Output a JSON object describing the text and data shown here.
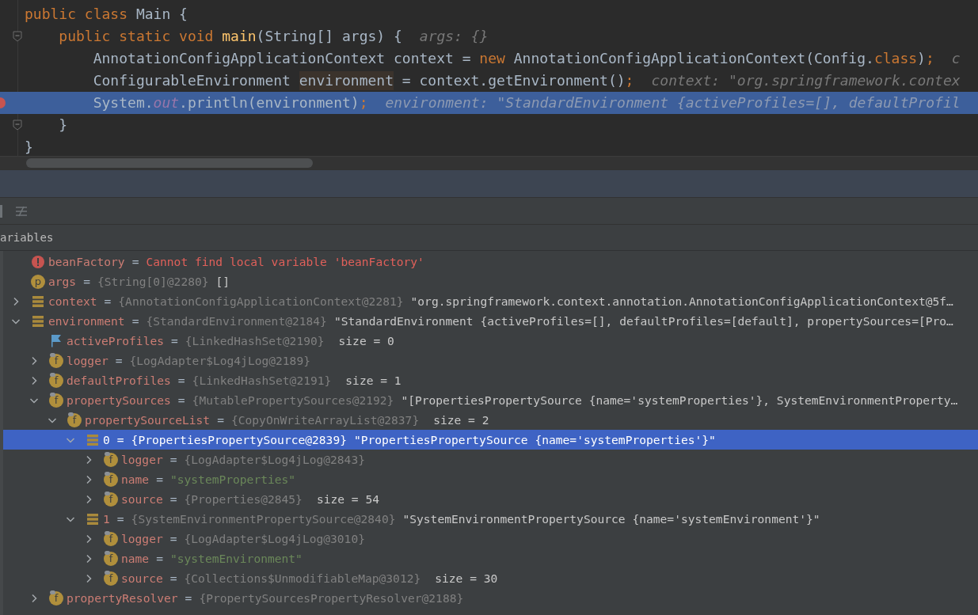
{
  "editor": {
    "lines": [
      {
        "selected": false,
        "fold": false,
        "breakpoint": false,
        "tokens": [
          {
            "kind": "keyword",
            "text": "public class "
          },
          {
            "kind": "plain",
            "text": "Main {"
          }
        ]
      },
      {
        "selected": false,
        "fold": true,
        "breakpoint": false,
        "tokens": [
          {
            "kind": "keyword",
            "text": "    public static void "
          },
          {
            "kind": "function",
            "text": "main"
          },
          {
            "kind": "plain",
            "text": "(String[] args) {"
          },
          {
            "kind": "hint",
            "text": "args: {}"
          }
        ]
      },
      {
        "selected": false,
        "fold": false,
        "breakpoint": false,
        "tokens": [
          {
            "kind": "plain",
            "text": "        AnnotationConfigApplicationContext context = "
          },
          {
            "kind": "keyword",
            "text": "new"
          },
          {
            "kind": "plain",
            "text": " AnnotationConfigApplicationContext(Config."
          },
          {
            "kind": "keyword",
            "text": "class"
          },
          {
            "kind": "plain",
            "text": ")"
          },
          {
            "kind": "keyword",
            "text": ";"
          },
          {
            "kind": "hint",
            "text": "c"
          }
        ]
      },
      {
        "selected": false,
        "fold": false,
        "breakpoint": false,
        "tokens": [
          {
            "kind": "plain",
            "text": "        ConfigurableEnvironment "
          },
          {
            "kind": "usage",
            "text": "environment"
          },
          {
            "kind": "plain",
            "text": " = context.getEnvironment()"
          },
          {
            "kind": "keyword",
            "text": ";"
          },
          {
            "kind": "hint",
            "text": "context: \"org.springframework.contex"
          }
        ]
      },
      {
        "selected": true,
        "fold": false,
        "breakpoint": true,
        "tokens": [
          {
            "kind": "plain",
            "text": "        System."
          },
          {
            "kind": "static",
            "text": "out"
          },
          {
            "kind": "plain",
            "text": ".println(environment)"
          },
          {
            "kind": "keyword",
            "text": ";"
          },
          {
            "kind": "hint",
            "text": "environment: \"StandardEnvironment {activeProfiles=[], defaultProfil"
          }
        ]
      },
      {
        "selected": false,
        "fold": true,
        "breakpoint": false,
        "tokens": [
          {
            "kind": "plain",
            "text": "    }"
          }
        ]
      },
      {
        "selected": false,
        "fold": false,
        "breakpoint": false,
        "tokens": [
          {
            "kind": "plain",
            "text": "}"
          }
        ]
      }
    ]
  },
  "panel": {
    "header": "ariables"
  },
  "variables": [
    {
      "kind": "error",
      "selected": false,
      "name": "beanFactory",
      "eq": "=",
      "value": {
        "kind": "error",
        "text": "Cannot find local variable 'beanFactory'"
      }
    },
    {
      "kind": "param",
      "badge": "p",
      "selected": false,
      "name": "args",
      "eq": "=",
      "type": "{String[0]@2280}",
      "value": {
        "kind": "plain",
        "text": "[]"
      }
    },
    {
      "kind": "object",
      "selected": false,
      "expanded": false,
      "name": "context",
      "eq": "=",
      "type": "{AnnotationConfigApplicationContext@2281}",
      "value": {
        "kind": "plain",
        "text": "\"org.springframework.context.annotation.AnnotationConfigApplicationContext@5f…"
      }
    },
    {
      "kind": "object",
      "selected": false,
      "expanded": true,
      "name": "environment",
      "eq": "=",
      "type": "{StandardEnvironment@2184}",
      "value": {
        "kind": "plain",
        "text": "\"StandardEnvironment {activeProfiles=[], defaultProfiles=[default], propertySources=[Pro…"
      },
      "children": [
        {
          "kind": "flag",
          "selected": false,
          "name": "activeProfiles",
          "eq": "=",
          "type": "{LinkedHashSet@2190}",
          "value": {
            "kind": "size",
            "text": "size = 0"
          }
        },
        {
          "kind": "field",
          "badge": "f",
          "selected": false,
          "expanded": false,
          "name": "logger",
          "eq": "=",
          "type": "{LogAdapter$Log4jLog@2189}"
        },
        {
          "kind": "field",
          "badge": "f",
          "selected": false,
          "expanded": false,
          "name": "defaultProfiles",
          "eq": "=",
          "type": "{LinkedHashSet@2191}",
          "value": {
            "kind": "size",
            "text": "size = 1"
          }
        },
        {
          "kind": "field",
          "badge": "f",
          "selected": false,
          "expanded": true,
          "name": "propertySources",
          "eq": "=",
          "type": "{MutablePropertySources@2192}",
          "value": {
            "kind": "plain",
            "text": "\"[PropertiesPropertySource {name='systemProperties'}, SystemEnvironmentProperty…"
          },
          "children": [
            {
              "kind": "field",
              "badge": "f",
              "selected": false,
              "expanded": true,
              "name": "propertySourceList",
              "eq": "=",
              "type": "{CopyOnWriteArrayList@2837}",
              "value": {
                "kind": "size",
                "text": "size = 2"
              },
              "children": [
                {
                  "kind": "object",
                  "selected": true,
                  "expanded": true,
                  "name": "0",
                  "eq": "=",
                  "type": "{PropertiesPropertySource@2839}",
                  "value": {
                    "kind": "plain",
                    "text": "\"PropertiesPropertySource {name='systemProperties'}\""
                  },
                  "children": [
                    {
                      "kind": "field",
                      "badge": "f",
                      "selected": false,
                      "expanded": false,
                      "name": "logger",
                      "eq": "=",
                      "type": "{LogAdapter$Log4jLog@2843}"
                    },
                    {
                      "kind": "field",
                      "badge": "f",
                      "selected": false,
                      "expanded": false,
                      "name": "name",
                      "eq": "=",
                      "value": {
                        "kind": "string",
                        "text": "\"systemProperties\""
                      }
                    },
                    {
                      "kind": "field",
                      "badge": "f",
                      "selected": false,
                      "expanded": false,
                      "name": "source",
                      "eq": "=",
                      "type": "{Properties@2845}",
                      "value": {
                        "kind": "size",
                        "text": "size = 54"
                      }
                    }
                  ]
                },
                {
                  "kind": "object",
                  "selected": false,
                  "expanded": true,
                  "name": "1",
                  "eq": "=",
                  "type": "{SystemEnvironmentPropertySource@2840}",
                  "value": {
                    "kind": "plain",
                    "text": "\"SystemEnvironmentPropertySource {name='systemEnvironment'}\""
                  },
                  "children": [
                    {
                      "kind": "field",
                      "badge": "f",
                      "selected": false,
                      "expanded": false,
                      "name": "logger",
                      "eq": "=",
                      "type": "{LogAdapter$Log4jLog@3010}"
                    },
                    {
                      "kind": "field",
                      "badge": "f",
                      "selected": false,
                      "expanded": false,
                      "name": "name",
                      "eq": "=",
                      "value": {
                        "kind": "string",
                        "text": "\"systemEnvironment\""
                      }
                    },
                    {
                      "kind": "field",
                      "badge": "f",
                      "selected": false,
                      "expanded": false,
                      "name": "source",
                      "eq": "=",
                      "type": "{Collections$UnmodifiableMap@3012}",
                      "value": {
                        "kind": "size",
                        "text": "size = 30"
                      }
                    }
                  ]
                }
              ]
            }
          ]
        },
        {
          "kind": "field",
          "badge": "f",
          "selected": false,
          "expanded": false,
          "name": "propertyResolver",
          "eq": "=",
          "type": "{PropertySourcesPropertyResolver@2188}"
        }
      ]
    }
  ]
}
